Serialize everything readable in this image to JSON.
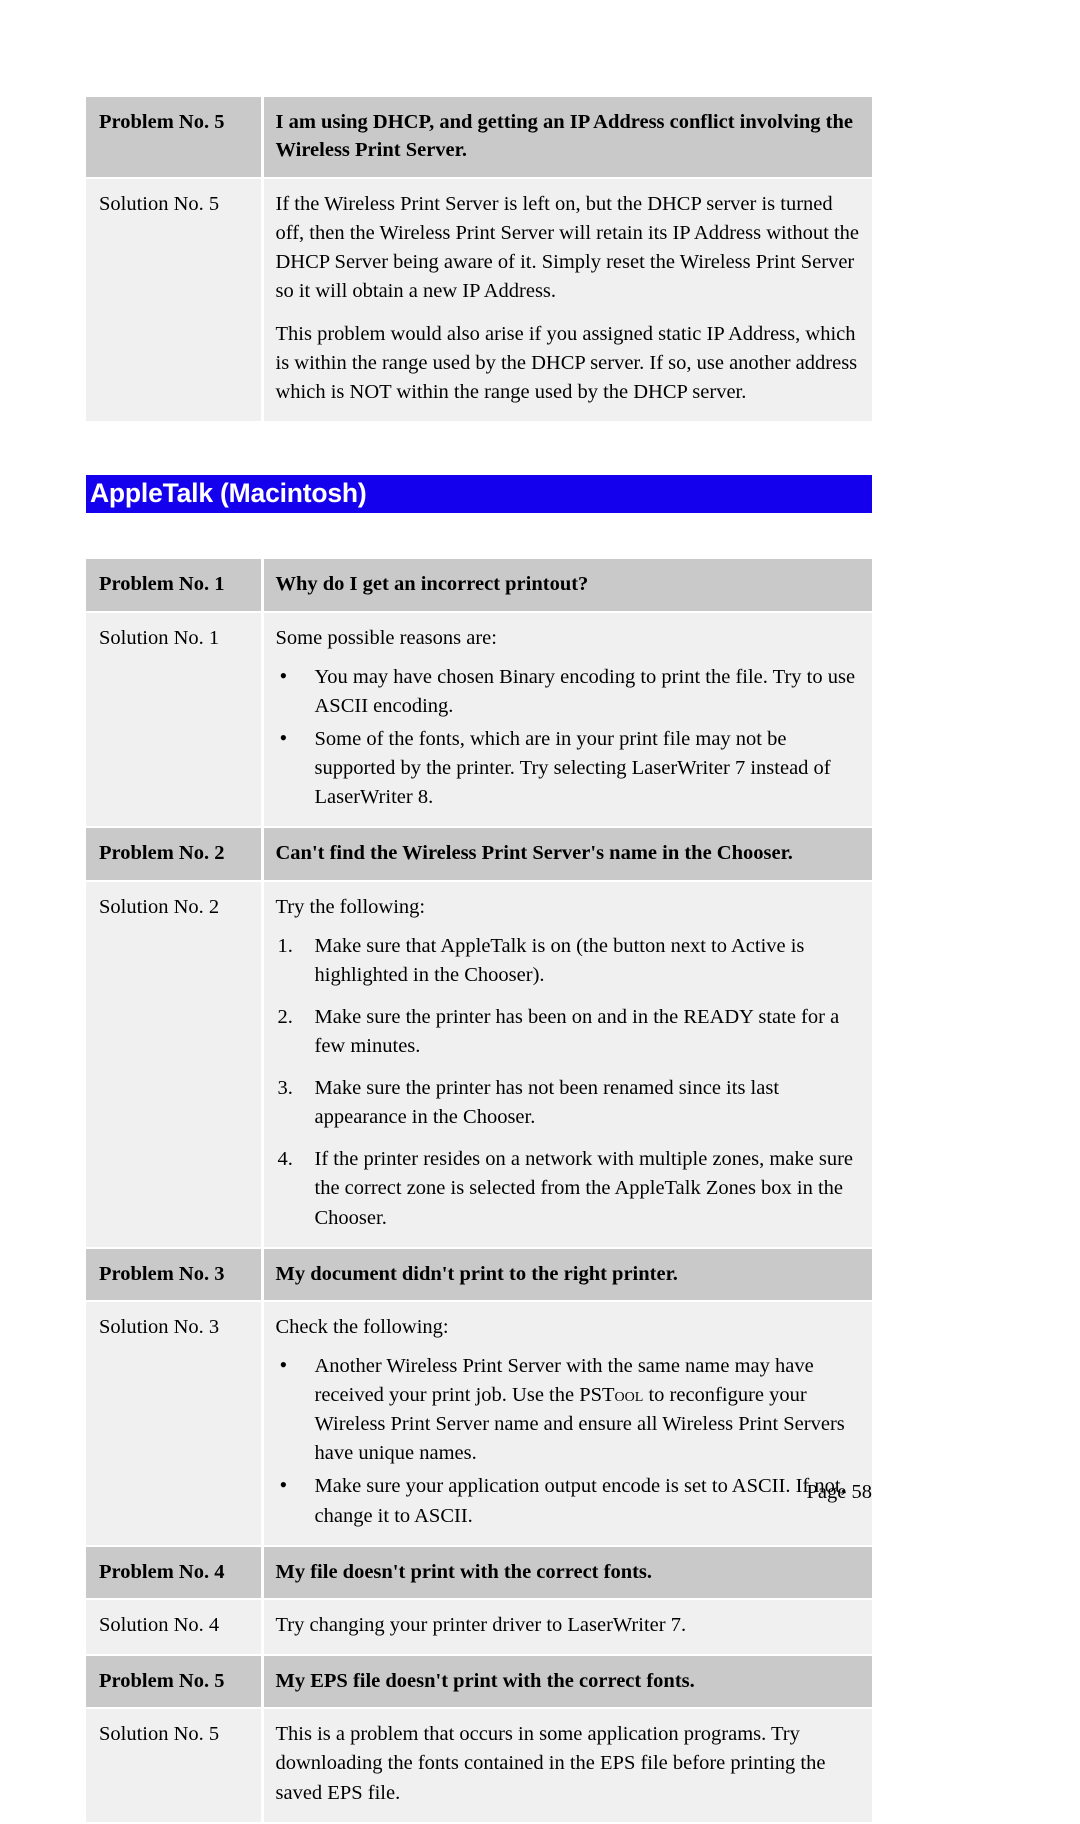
{
  "page": {
    "footer_page_label": "Page 58"
  },
  "top_table": {
    "rows": [
      {
        "label": "Problem No. 5",
        "text": "I am using DHCP, and getting an IP Address conflict involving the Wireless Print Server."
      },
      {
        "label": "Solution No. 5",
        "paragraph_1": "If the Wireless Print Server is left on, but the DHCP server is turned off, then the Wireless Print Server will retain its IP Address without the DHCP Server being aware of it. Simply reset the Wireless Print Server so it will obtain a new IP Address.",
        "paragraph_2": "This problem would also arise if you assigned static IP Address, which is within the range used by the DHCP server. If so, use another address which is NOT within the range used by the DHCP server."
      }
    ]
  },
  "section": {
    "title": "AppleTalk (Macintosh)",
    "banner_color": "#1500ee",
    "banner_text_color": "#ffffff"
  },
  "appletalk_table": {
    "problem_1": {
      "label": "Problem No. 1",
      "text": "Why do I get an incorrect printout?"
    },
    "solution_1": {
      "label": "Solution No. 1",
      "intro": "Some possible reasons are:",
      "bullets": [
        "You may have chosen Binary encoding to print the file. Try to use ASCII encoding.",
        "Some of the fonts, which are in your print file may not be supported by the printer. Try selecting LaserWriter 7 instead of LaserWriter 8."
      ]
    },
    "problem_2": {
      "label": "Problem No. 2",
      "text": "Can't find the Wireless Print Server's name in the Chooser."
    },
    "solution_2": {
      "label": "Solution No. 2",
      "intro": "Try the following:",
      "steps": [
        "Make sure that AppleTalk is on (the button next to Active is highlighted in the Chooser).",
        "Make sure the printer has been on and in the READY state for a few minutes.",
        "Make sure the printer has not been renamed since its last appearance in the Chooser.",
        "If the printer resides on a network with multiple zones, make sure the correct zone is selected from the AppleTalk Zones box in the Chooser."
      ]
    },
    "problem_3": {
      "label": "Problem No. 3",
      "text": "My document didn't print to the right printer."
    },
    "solution_3": {
      "label": "Solution No. 3",
      "intro": "Check the following:",
      "bullet_1_part_a": "Another Wireless Print Server with the same name may have received your print job. Use the ",
      "bullet_1_smallcaps": "PSTool",
      "bullet_1_part_b": " to reconfigure your Wireless Print Server name and ensure all Wireless Print Servers have unique names.",
      "bullet_2": "Make sure your application output encode is set to ASCII. If not, change it to ASCII."
    },
    "problem_4": {
      "label": "Problem No. 4",
      "text": "My file doesn't print with the correct fonts."
    },
    "solution_4": {
      "label": "Solution No. 4",
      "text": "Try changing your printer driver to LaserWriter 7."
    },
    "problem_5": {
      "label": "Problem No. 5",
      "text": "My EPS file doesn't print with the correct fonts."
    },
    "solution_5": {
      "label": "Solution No. 5",
      "text": "This is a problem that occurs in some application programs.  Try downloading the fonts contained in the EPS file before printing the saved EPS file."
    }
  }
}
